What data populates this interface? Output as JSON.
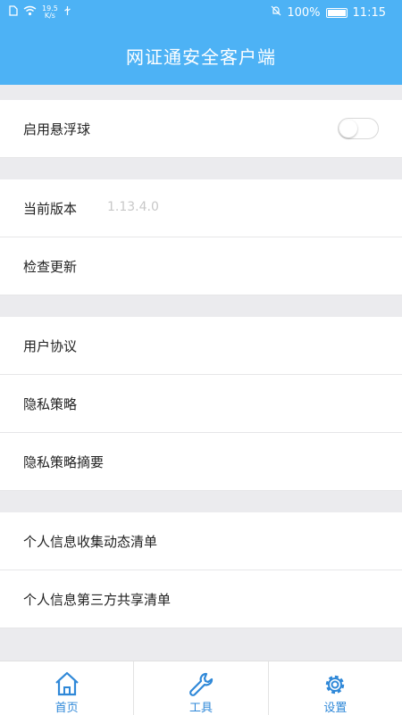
{
  "status_bar": {
    "net_speed_value": "19.5",
    "net_speed_unit": "K/s",
    "battery": "100%",
    "time": "11:15"
  },
  "header": {
    "title": "网证通安全客户端"
  },
  "settings": {
    "float_ball": {
      "label": "启用悬浮球",
      "enabled": false
    },
    "version": {
      "label": "当前版本",
      "value": "1.13.4.0"
    },
    "check_update": "检查更新",
    "user_agreement": "用户协议",
    "privacy_policy": "隐私策略",
    "privacy_summary": "隐私策略摘要",
    "info_collection_list": "个人信息收集动态清单",
    "third_party_sharing_list": "个人信息第三方共享清单"
  },
  "tabs": [
    {
      "label": "首页",
      "icon": "home-icon"
    },
    {
      "label": "工具",
      "icon": "wrench-icon"
    },
    {
      "label": "设置",
      "icon": "gear-icon"
    }
  ],
  "colors": {
    "accent": "#4db2f5",
    "tab_icon": "#2f88d8",
    "background": "#ebebee"
  }
}
